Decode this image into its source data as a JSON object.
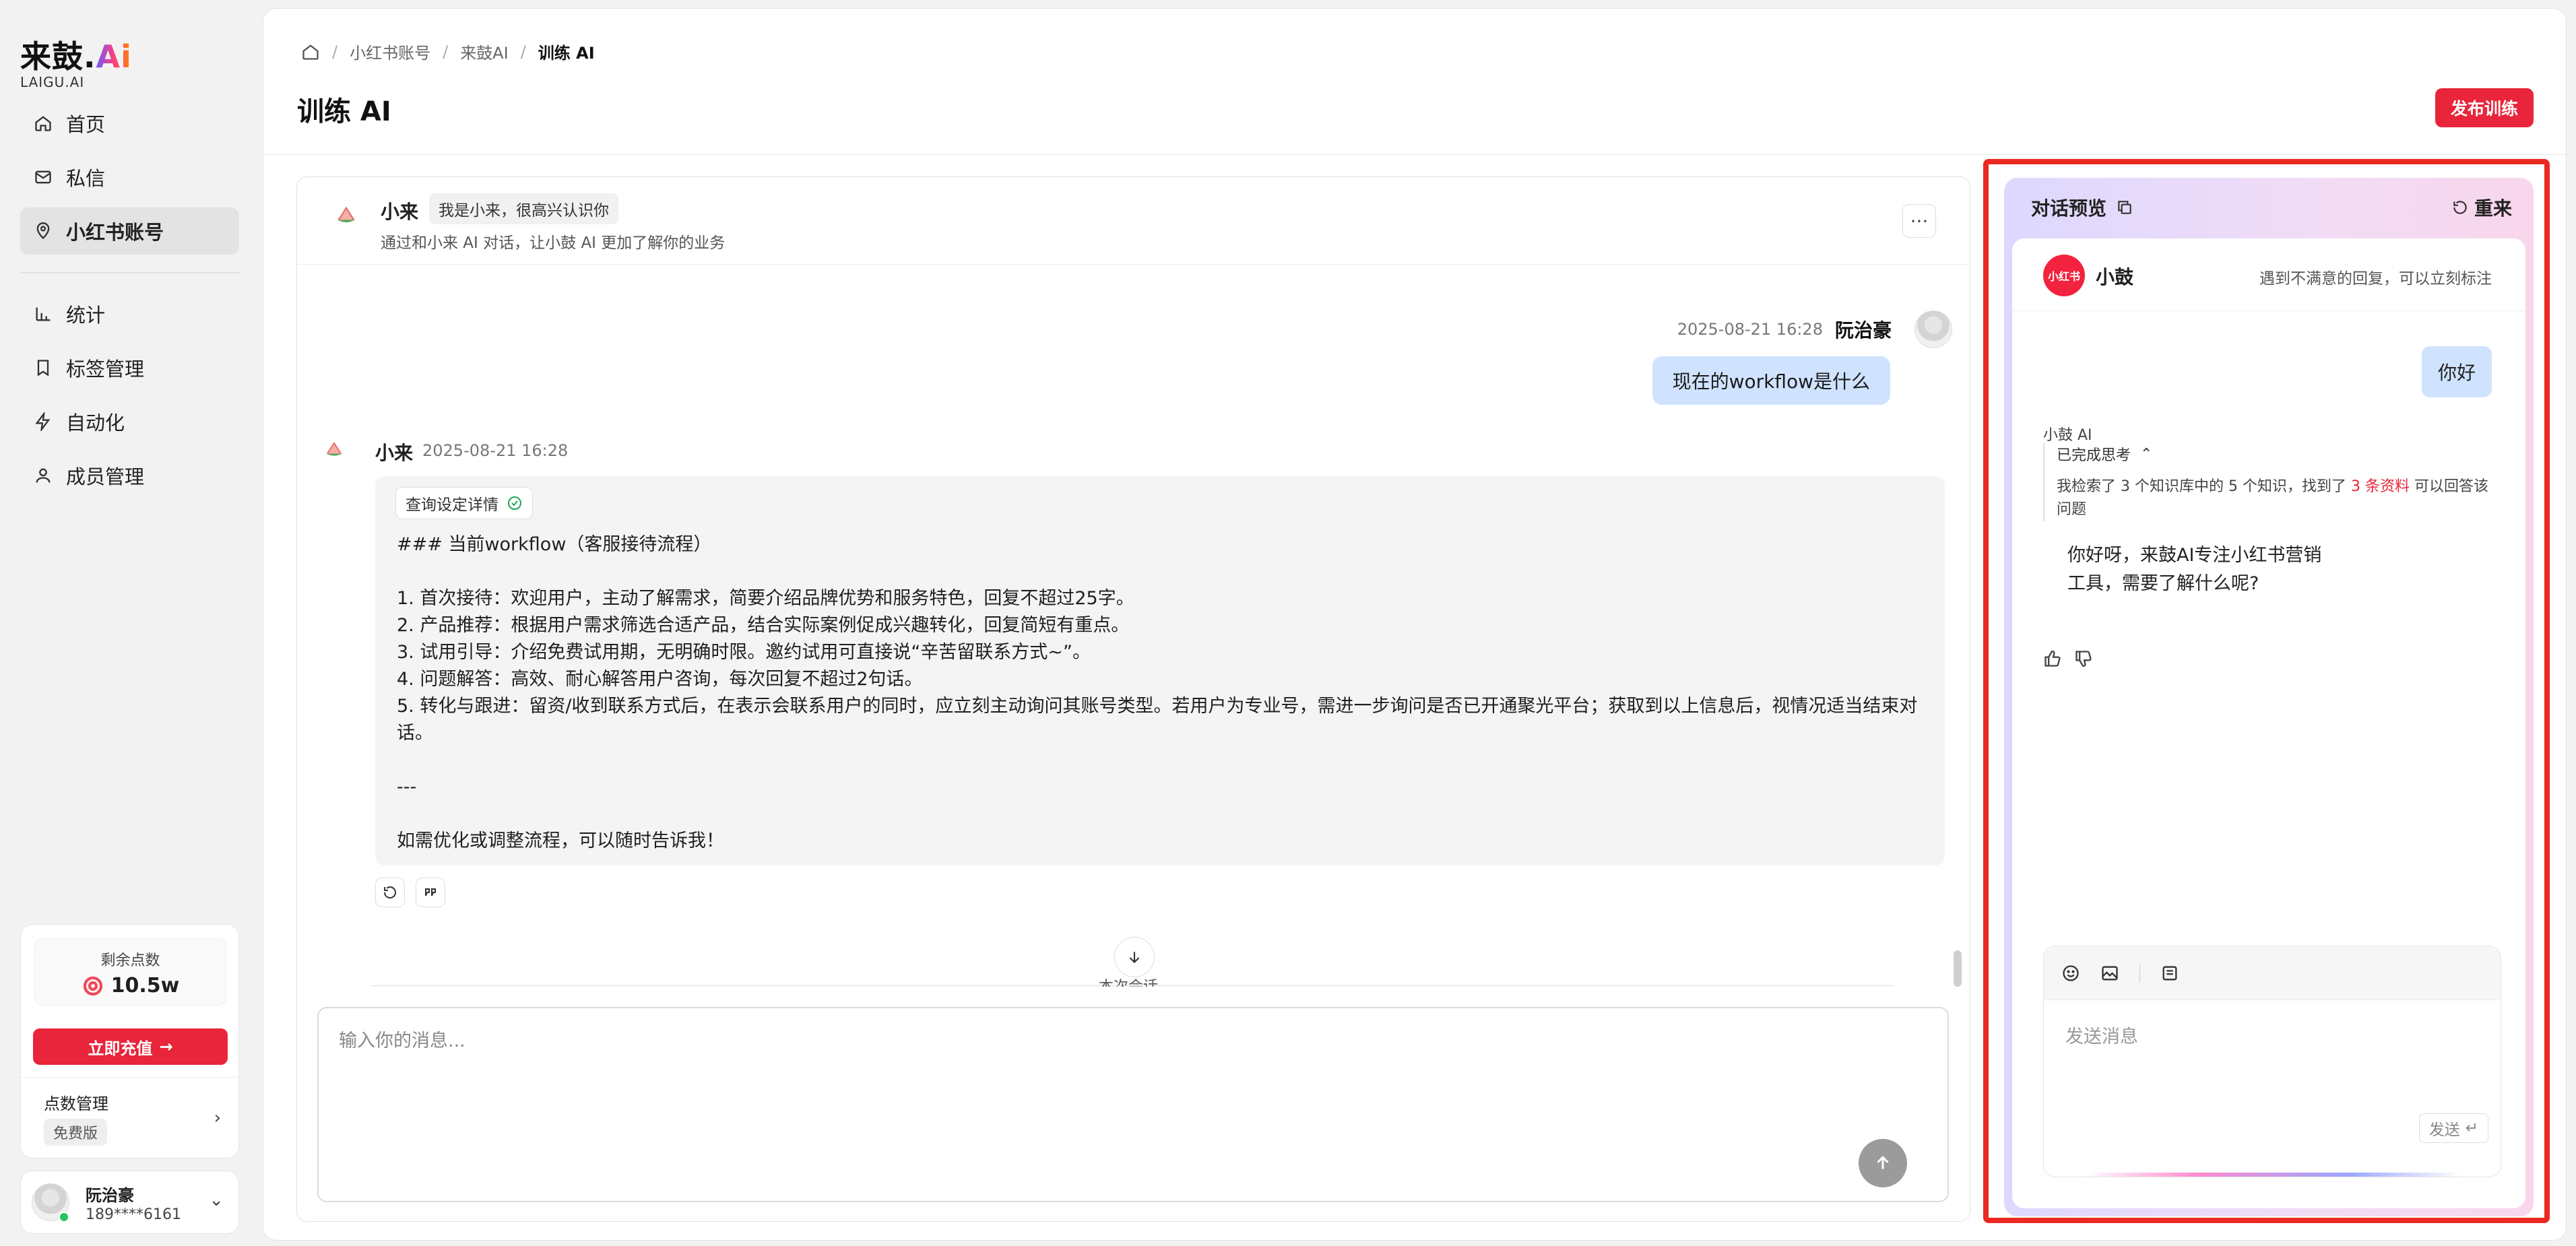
{
  "logo": {
    "main": "来鼓.",
    "ai": "Ai",
    "sub": "LAIGU.AI"
  },
  "sidebar": {
    "items": [
      {
        "label": "首页",
        "icon": "home-icon"
      },
      {
        "label": "私信",
        "icon": "mail-icon"
      },
      {
        "label": "小红书账号",
        "icon": "location-pin-icon",
        "active": true
      },
      {
        "label": "统计",
        "icon": "bar-chart-icon"
      },
      {
        "label": "标签管理",
        "icon": "bookmark-icon"
      },
      {
        "label": "自动化",
        "icon": "lightning-icon"
      },
      {
        "label": "成员管理",
        "icon": "user-icon"
      }
    ],
    "points": {
      "label": "剩余点数",
      "value": "10.5w",
      "recharge_label": "立即充值",
      "manage_label": "点数管理",
      "plan_badge": "免费版"
    },
    "user": {
      "name": "阮治豪",
      "phone": "189****6161"
    }
  },
  "header": {
    "breadcrumb": [
      "小红书账号",
      "来鼓AI",
      "训练 AI"
    ],
    "title": "训练 AI",
    "publish_label": "发布训练"
  },
  "chat": {
    "bot_name": "小来",
    "bot_tag": "我是小来，很高兴认识你",
    "description": "通过和小来 AI 对话，让小鼓 AI 更加了解你的业务",
    "more_label": "···",
    "user_message": {
      "time": "2025-08-21 16:28",
      "name": "阮治豪",
      "text": "现在的workflow是什么"
    },
    "bot_message": {
      "name": "小来",
      "time": "2025-08-21 16:28",
      "chip": "查询设定详情",
      "lines": [
        "### 当前workflow（客服接待流程）",
        "",
        "1. 首次接待：欢迎用户，主动了解需求，简要介绍品牌优势和服务特色，回复不超过25字。",
        "2. 产品推荐：根据用户需求筛选合适产品，结合实际案例促成兴趣转化，回复简短有重点。",
        "3. 试用引导：介绍免费试用期，无明确时限。邀约试用可直接说“辛苦留联系方式~”。",
        "4. 问题解答：高效、耐心解答用户咨询，每次回复不超过2句话。",
        "5. 转化与跟进：留资/收到联系方式后，在表示会联系用户的同时，应立刻主动询问其账号类型。若用户为专业号，需进一步询问是否已开通聚光平台；获取到以上信息后，视情况适当结束对话。",
        "",
        "---",
        "",
        "如需优化或调整流程，可以随时告诉我！"
      ]
    },
    "session_label": "本次会话",
    "input_placeholder": "输入你的消息..."
  },
  "preview": {
    "title": "对话预览",
    "restart_label": "重来",
    "logo_text": "小红书",
    "name": "小鼓",
    "hint": "遇到不满意的回复，可以立刻标注",
    "user_text": "你好",
    "ai_label": "小鼓 AI",
    "think_title": "已完成思考",
    "think_body_before": "我检索了 3 个知识库中的 5 个知识，找到了 ",
    "think_body_highlight": "3 条资料",
    "think_body_after": " 可以回答该问题",
    "answer": "你好呀，来鼓AI专注小红书营销工具，需要了解什么呢?",
    "compose_placeholder": "发送消息",
    "send_label": "发送"
  },
  "colors": {
    "brand_red": "#e8253a",
    "user_bubble": "#cfe3ff",
    "highlight_outline": "#ea2a22"
  }
}
